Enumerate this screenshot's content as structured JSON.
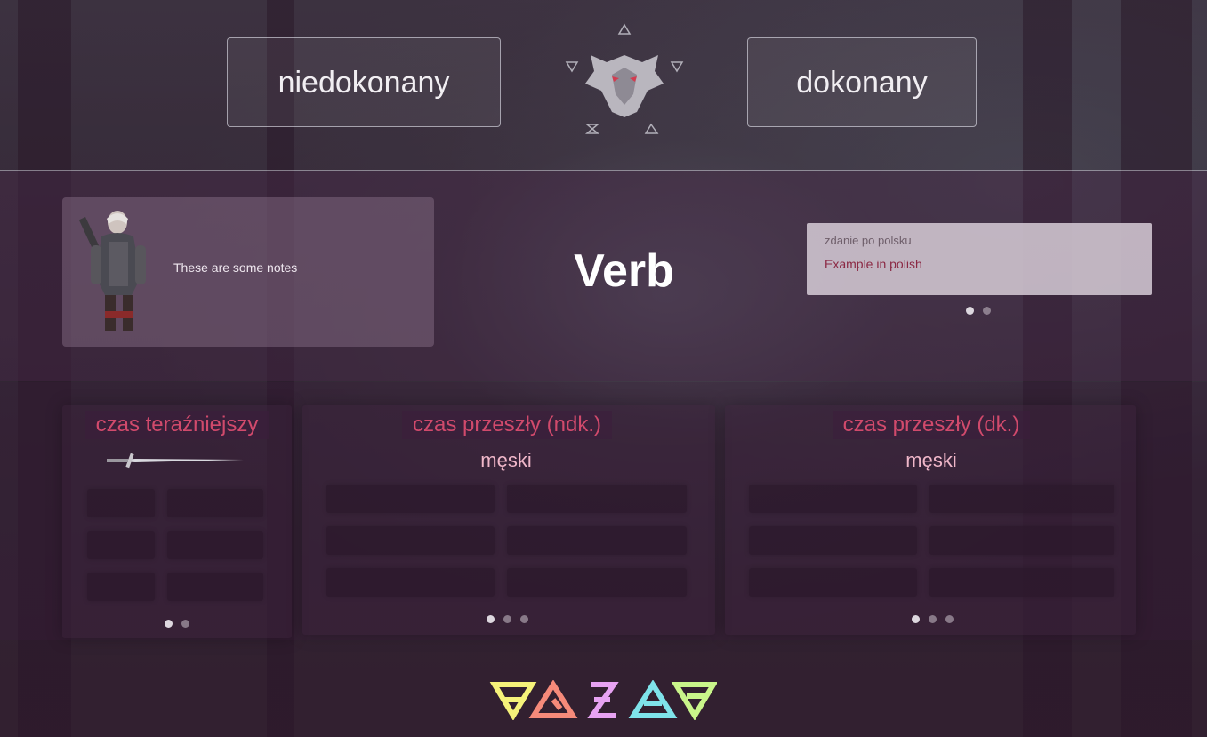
{
  "header": {
    "left_aspect": "niedokonany",
    "right_aspect": "dokonany"
  },
  "card": {
    "notes": "These are some notes",
    "word": "Verb",
    "example_pl_placeholder": "zdanie po polsku",
    "example_en": "Example in polish"
  },
  "tenses": {
    "present": {
      "title": "czas teraźniejszy"
    },
    "past_imperfective": {
      "title": "czas przeszły (ndk.)",
      "gender": "męski"
    },
    "past_perfective": {
      "title": "czas przeszły (dk.)",
      "gender": "męski"
    }
  },
  "colors": {
    "accent": "#d14a6c",
    "gender_text": "#f0b7c9",
    "example_text": "#8b2843",
    "sign_yellow": "#f5f27a",
    "sign_red": "#f58a7a",
    "sign_pink": "#e7a2f2",
    "sign_cyan": "#7fe3ea",
    "sign_green": "#c9f58a"
  },
  "icons": {
    "header_emblem": "wolf-medallion-icon",
    "notes_image": "witcher-portrait",
    "divider": "sword-icon",
    "footer": [
      "aard-sign-icon",
      "igni-sign-icon",
      "yrden-sign-icon",
      "quen-sign-icon",
      "axii-sign-icon"
    ]
  },
  "carousels": {
    "example_active": 0,
    "present_active": 0,
    "past_ndk_active": 0,
    "past_dk_active": 0
  }
}
